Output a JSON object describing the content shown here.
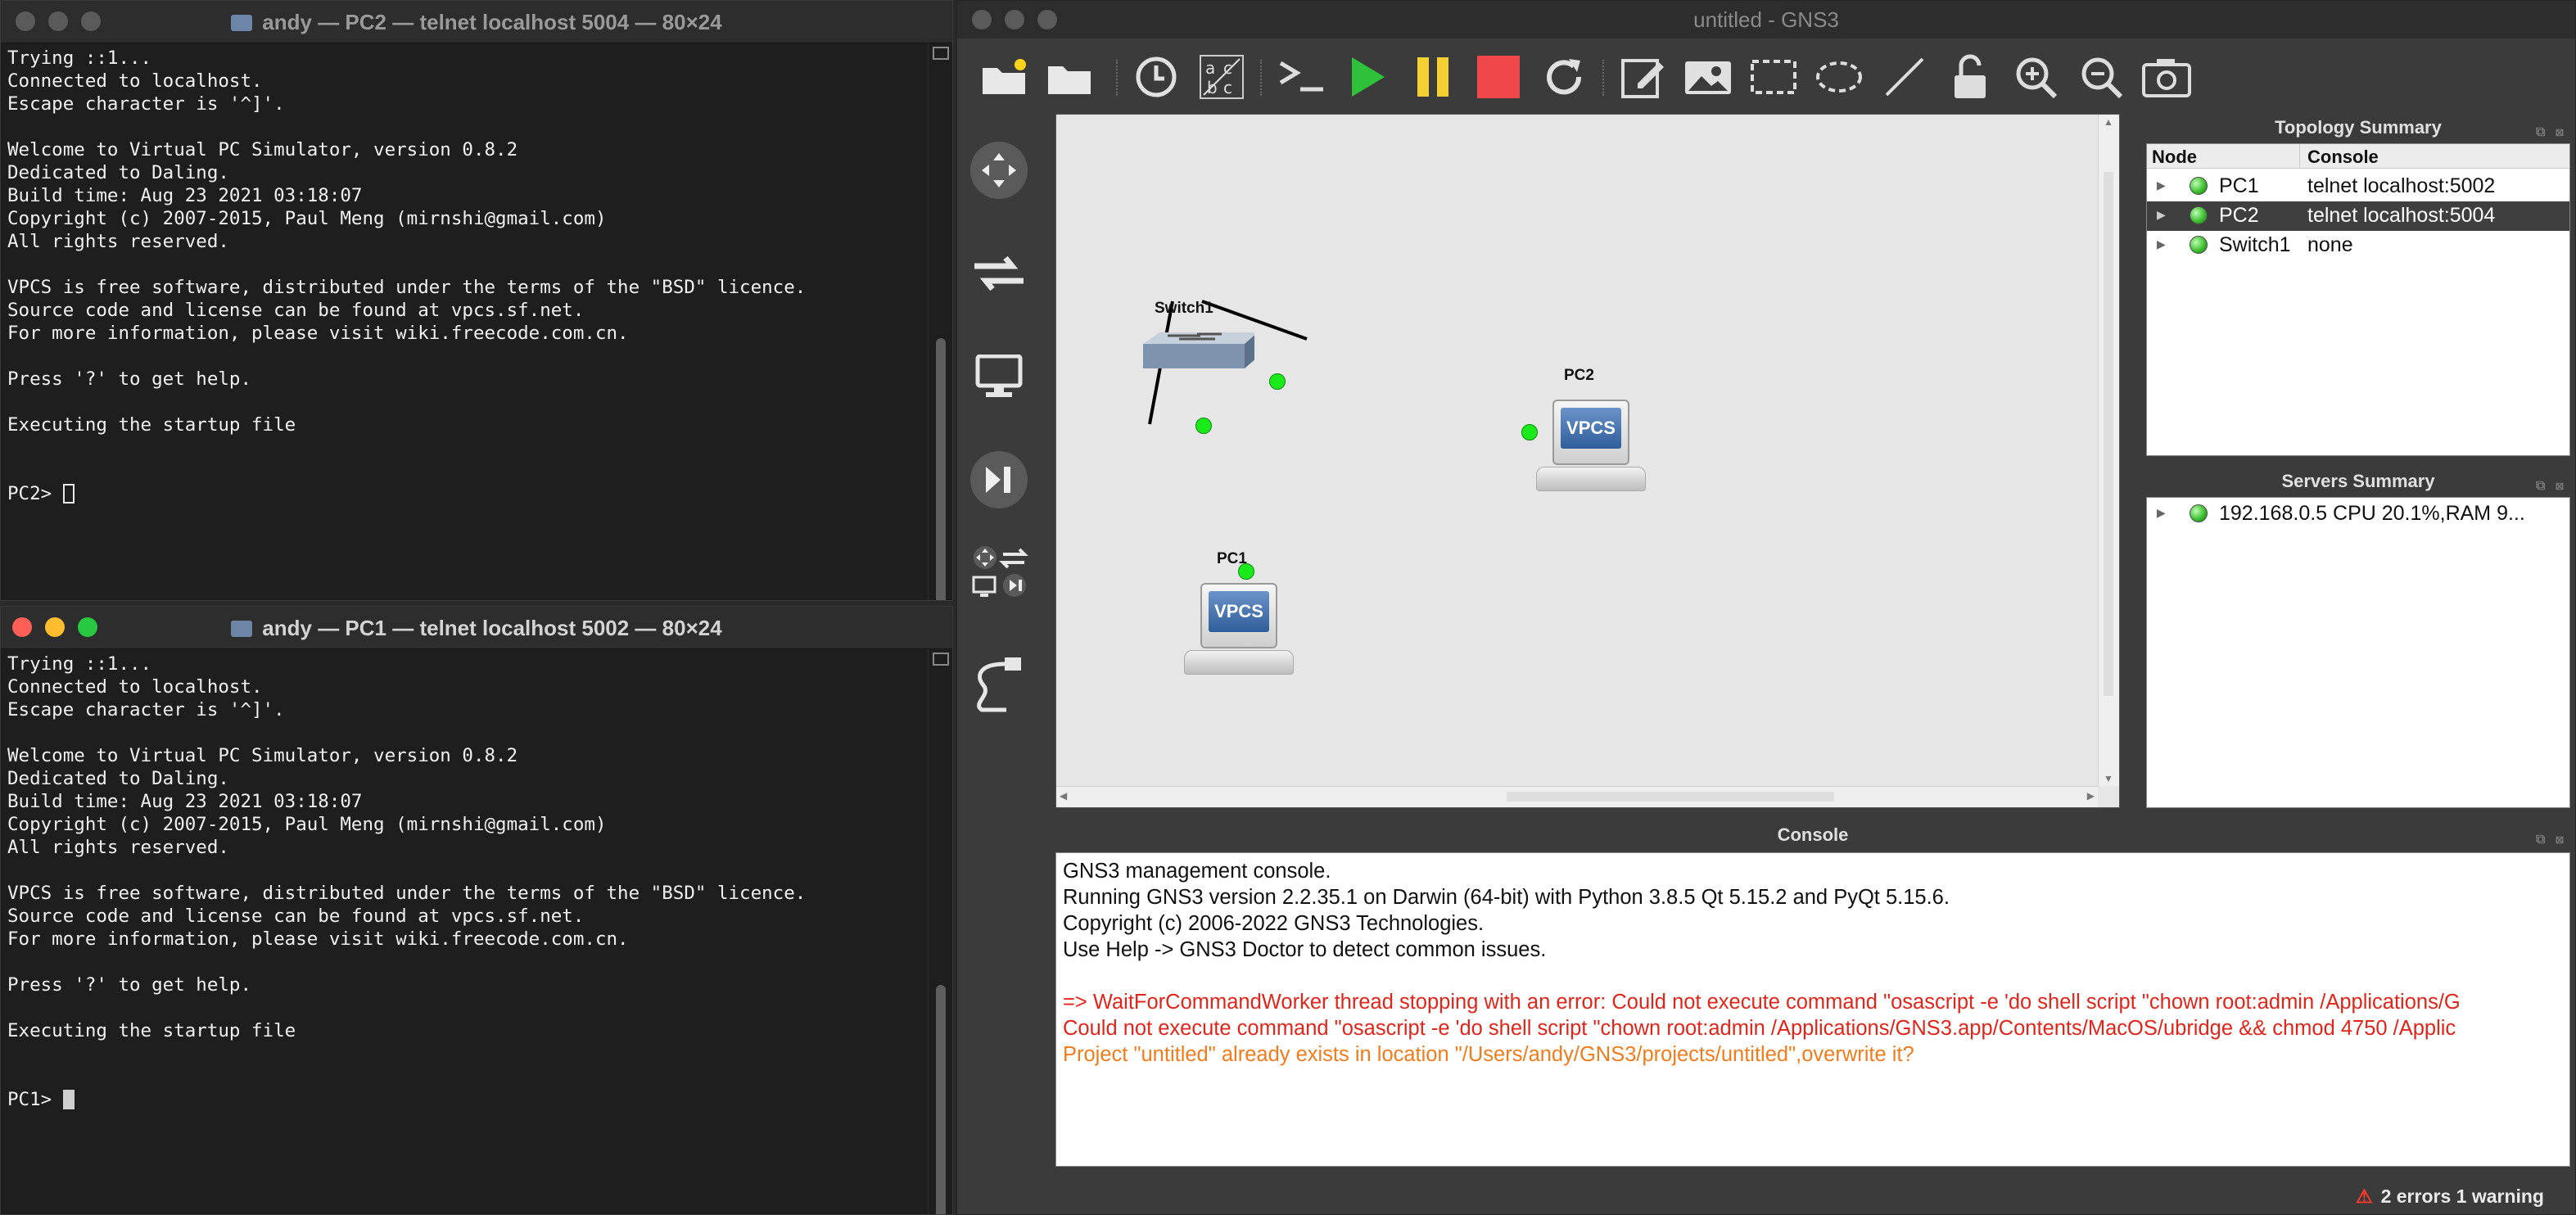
{
  "terminal_pc2": {
    "title": "andy — PC2 — telnet localhost 5004 — 80×24",
    "lines": [
      "Trying ::1...",
      "Connected to localhost.",
      "Escape character is '^]'.",
      "",
      "Welcome to Virtual PC Simulator, version 0.8.2",
      "Dedicated to Daling.",
      "Build time: Aug 23 2021 03:18:07",
      "Copyright (c) 2007-2015, Paul Meng (mirnshi@gmail.com)",
      "All rights reserved.",
      "",
      "VPCS is free software, distributed under the terms of the \"BSD\" licence.",
      "Source code and license can be found at vpcs.sf.net.",
      "For more information, please visit wiki.freecode.com.cn.",
      "",
      "Press '?' to get help.",
      "",
      "Executing the startup file",
      "",
      ""
    ],
    "prompt": "PC2> "
  },
  "terminal_pc1": {
    "title": "andy — PC1 — telnet localhost 5002 — 80×24",
    "lines": [
      "Trying ::1...",
      "Connected to localhost.",
      "Escape character is '^]'.",
      "",
      "Welcome to Virtual PC Simulator, version 0.8.2",
      "Dedicated to Daling.",
      "Build time: Aug 23 2021 03:18:07",
      "Copyright (c) 2007-2015, Paul Meng (mirnshi@gmail.com)",
      "All rights reserved.",
      "",
      "VPCS is free software, distributed under the terms of the \"BSD\" licence.",
      "Source code and license can be found at vpcs.sf.net.",
      "For more information, please visit wiki.freecode.com.cn.",
      "",
      "Press '?' to get help.",
      "",
      "Executing the startup file",
      "",
      ""
    ],
    "prompt": "PC1> "
  },
  "gns3": {
    "title": "untitled - GNS3",
    "colors": {
      "link_status": "#1aea1a",
      "error": "#e1251b",
      "warning": "#f07c1b",
      "selected_row": "#3f3f3f"
    },
    "topology": {
      "switch_label": "Switch1",
      "pc1_label": "PC1",
      "pc2_label": "PC2",
      "vpcs_text": "VPCS"
    },
    "topology_summary": {
      "title": "Topology Summary",
      "col_node": "Node",
      "col_console": "Console",
      "rows": [
        {
          "node": "PC1",
          "console": "telnet localhost:5002"
        },
        {
          "node": "PC2",
          "console": "telnet localhost:5004"
        },
        {
          "node": "Switch1",
          "console": "none"
        }
      ]
    },
    "servers_summary": {
      "title": "Servers Summary",
      "rows": [
        {
          "server": "192.168.0.5 CPU 20.1%,RAM 9..."
        }
      ]
    },
    "console": {
      "title": "Console",
      "lines": [
        {
          "text": "GNS3 management console.",
          "kind": "normal"
        },
        {
          "text": "Running GNS3 version 2.2.35.1 on Darwin (64-bit) with Python 3.8.5 Qt 5.15.2 and PyQt 5.15.6.",
          "kind": "normal"
        },
        {
          "text": "Copyright (c) 2006-2022 GNS3 Technologies.",
          "kind": "normal"
        },
        {
          "text": "Use Help -> GNS3 Doctor to detect common issues.",
          "kind": "normal"
        },
        {
          "text": "",
          "kind": "normal"
        },
        {
          "text": "=> WaitForCommandWorker thread stopping with an error: Could not execute command \"osascript -e 'do shell script \"chown root:admin /Applications/G",
          "kind": "err"
        },
        {
          "text": "Could not execute command \"osascript -e 'do shell script \"chown root:admin /Applications/GNS3.app/Contents/MacOS/ubridge && chmod 4750 /Applic",
          "kind": "err"
        },
        {
          "text": "Project \"untitled\" already exists in location \"/Users/andy/GNS3/projects/untitled\",overwrite it?",
          "kind": "warn"
        }
      ]
    },
    "status_bar": {
      "text": "2 errors 1 warning"
    },
    "toolbar_icons": [
      "new-project-icon",
      "open-project-icon",
      "snapshot-icon",
      "show-labels-icon",
      "console-all-icon",
      "start-all-icon",
      "pause-all-icon",
      "stop-all-icon",
      "reload-all-icon",
      "add-note-icon",
      "insert-picture-icon",
      "draw-rectangle-icon",
      "draw-ellipse-icon",
      "draw-line-icon",
      "lock-icon",
      "zoom-in-icon",
      "zoom-out-icon",
      "screenshot-icon"
    ],
    "device_icons": [
      "routers-icon",
      "switches-icon",
      "end-devices-icon",
      "security-devices-icon",
      "all-devices-icon",
      "add-link-icon"
    ]
  }
}
